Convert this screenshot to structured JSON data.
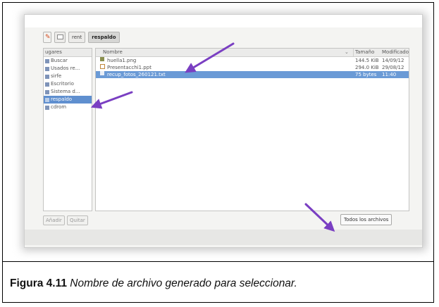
{
  "pathbar": {
    "segments": [
      "rent",
      "respaldo"
    ]
  },
  "places": {
    "header": "ugares",
    "items": [
      {
        "label": "Buscar",
        "selected": false
      },
      {
        "label": "Usados re...",
        "selected": false
      },
      {
        "label": "sirfe",
        "selected": false
      },
      {
        "label": "Escritorio",
        "selected": false
      },
      {
        "label": "Sistema d...",
        "selected": false
      },
      {
        "label": "respaldo",
        "selected": true
      },
      {
        "label": "cdrom",
        "selected": false
      }
    ],
    "add_label": "Añadir",
    "remove_label": "Quitar"
  },
  "files": {
    "columns": {
      "name": "Nombre",
      "size": "Tamaño",
      "modified": "Modificado"
    },
    "rows": [
      {
        "name": "huella1.png",
        "size": "144.5 KiB",
        "modified": "14/09/12",
        "selected": false,
        "icon": "image-file-icon"
      },
      {
        "name": "Presentacchi1.ppt",
        "size": "294.0 KiB",
        "modified": "29/08/12",
        "selected": false,
        "icon": "document-file-icon"
      },
      {
        "name": "recup_fotos_260121.txt",
        "size": "75 bytes",
        "modified": "11:40",
        "selected": true,
        "icon": "text-file-icon"
      }
    ]
  },
  "filter": {
    "label": "Todos los archivos"
  },
  "caption": {
    "number": "Figura 4.11",
    "text": "Nombre de archivo generado para seleccionar."
  },
  "colors": {
    "selection": "#6a9ad6",
    "arrow": "#7a3fc2"
  }
}
